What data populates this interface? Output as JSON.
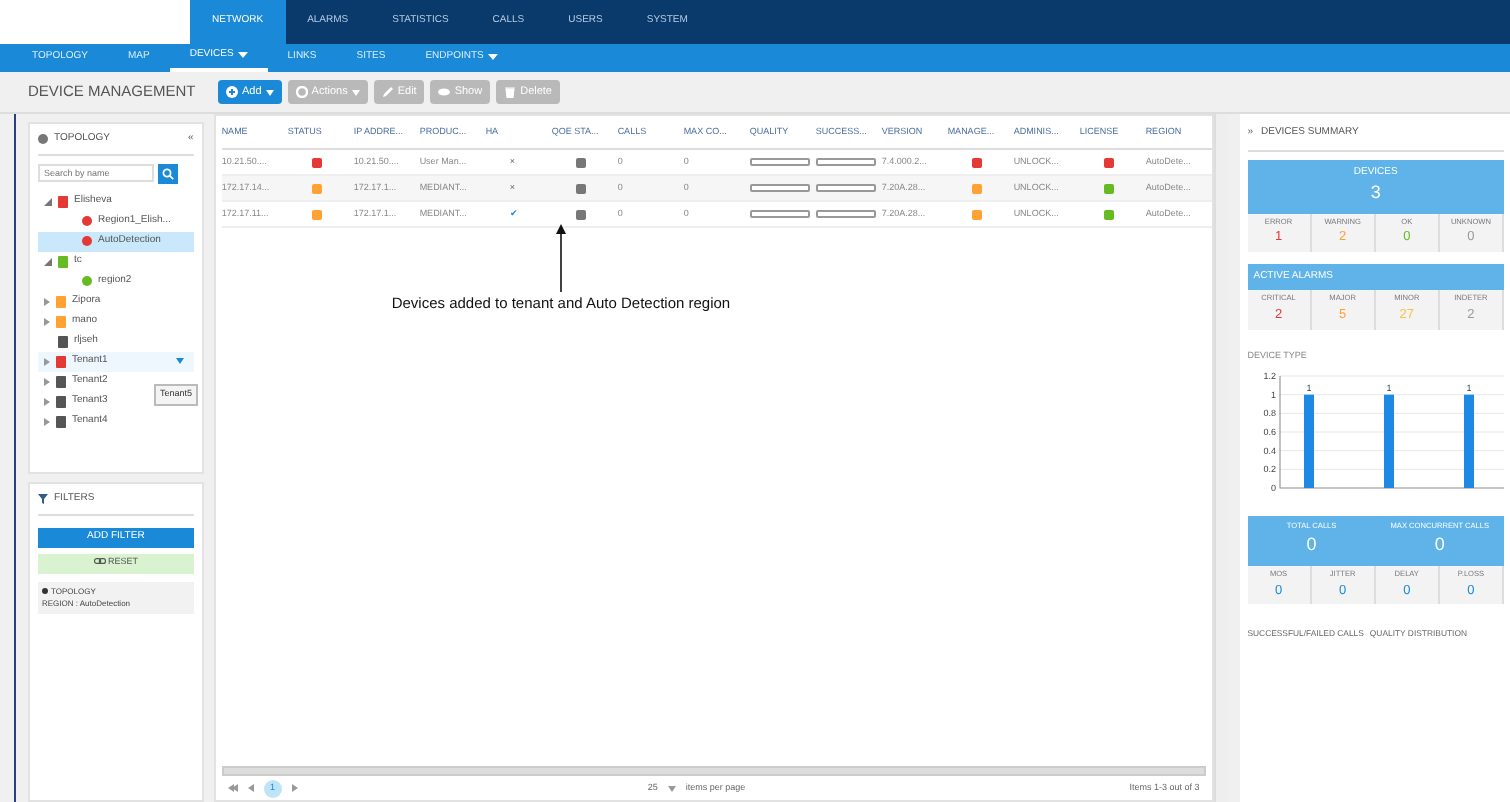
{
  "top_nav": {
    "tabs": [
      {
        "label": "NETWORK",
        "selected": true
      },
      {
        "label": "ALARMS",
        "selected": false
      },
      {
        "label": "STATISTICS",
        "selected": false
      },
      {
        "label": "CALLS",
        "selected": false
      },
      {
        "label": "USERS",
        "selected": false
      },
      {
        "label": "SYSTEM",
        "selected": false
      }
    ]
  },
  "sub_nav": {
    "tabs": [
      {
        "label": "TOPOLOGY",
        "selected": false,
        "dropdown": false
      },
      {
        "label": "MAP",
        "selected": false,
        "dropdown": false
      },
      {
        "label": "DEVICES",
        "selected": true,
        "dropdown": true
      },
      {
        "label": "LINKS",
        "selected": false,
        "dropdown": false
      },
      {
        "label": "SITES",
        "selected": false,
        "dropdown": false
      },
      {
        "label": "ENDPOINTS",
        "selected": false,
        "dropdown": true
      }
    ]
  },
  "page_title": "DEVICE MANAGEMENT",
  "toolbar": [
    {
      "label": "Add",
      "primary": true,
      "dropdown": true
    },
    {
      "label": "Actions",
      "primary": false,
      "dropdown": true
    },
    {
      "label": "Edit",
      "primary": false,
      "dropdown": false
    },
    {
      "label": "Show",
      "primary": false,
      "dropdown": false
    },
    {
      "label": "Delete",
      "primary": false,
      "dropdown": false
    }
  ],
  "topology": {
    "title": "TOPOLOGY",
    "collapse": "«",
    "search": {
      "placeholder": "Search by name"
    },
    "tree": [
      {
        "label": "Elisheva",
        "color": "#e53935",
        "kind": "tenant",
        "expanded": true,
        "selected": false,
        "children": [
          {
            "label": "Region1_Elish...",
            "color": "#e53935",
            "kind": "region",
            "selected": false
          },
          {
            "label": "AutoDetection",
            "color": "#e53935",
            "kind": "region",
            "selected": true
          }
        ]
      },
      {
        "label": "tc",
        "color": "#66bb22",
        "kind": "tenant",
        "expanded": true,
        "selected": false,
        "children": [
          {
            "label": "region2",
            "color": "#66bb22",
            "kind": "region",
            "selected": false
          }
        ]
      },
      {
        "label": "Zipora",
        "color": "#ffa133",
        "kind": "tenant",
        "expanded": false,
        "selected": false
      },
      {
        "label": "mano",
        "color": "#ffa133",
        "kind": "tenant",
        "expanded": false,
        "selected": false
      },
      {
        "label": "rljseh",
        "color": "#555555",
        "kind": "tenant",
        "selected": false
      },
      {
        "label": "Tenant1",
        "color": "#e53935",
        "kind": "tenant",
        "expanded": false,
        "selected": false,
        "hovered": true
      },
      {
        "label": "Tenant2",
        "color": "#555555",
        "kind": "tenant",
        "expanded": false,
        "selected": false
      },
      {
        "label": "Tenant3",
        "color": "#555555",
        "kind": "tenant",
        "expanded": false,
        "selected": false
      },
      {
        "label": "Tenant4",
        "color": "#555555",
        "kind": "tenant",
        "expanded": false,
        "selected": false
      }
    ],
    "tooltip": "Tenant5"
  },
  "filters": {
    "title": "FILTERS",
    "add_button": "ADD FILTER",
    "reset_button": "RESET",
    "active": [
      {
        "name": "TOPOLOGY",
        "value": "REGION : AutoDetection"
      }
    ]
  },
  "table": {
    "columns": [
      "NAME",
      "STATUS",
      "IP ADDRE...",
      "PRODUC...",
      "HA",
      "QOE STA...",
      "CALLS",
      "MAX CO...",
      "QUALITY",
      "SUCCESS...",
      "VERSION",
      "MANAGE...",
      "ADMINIS...",
      "LICENSE",
      "REGION"
    ],
    "rows": [
      {
        "name": "10.21.50....",
        "status": {
          "color": "#e53935"
        },
        "ip": "10.21.50....",
        "product": "User Man...",
        "ha": "×",
        "qoe": {
          "color": "#777777"
        },
        "calls": "0",
        "max_calls": "0",
        "quality": {
          "level": 0
        },
        "success": {
          "level": 0
        },
        "version": "7.4.000.2...",
        "manage": {
          "color": "#e53935"
        },
        "admin": "UNLOCK...",
        "license": {
          "color": "#e53935"
        },
        "region": "AutoDete..."
      },
      {
        "name": "172.17.14...",
        "status": {
          "color": "#ffa133"
        },
        "ip": "172.17.1...",
        "product": "MEDIANT...",
        "ha": "×",
        "qoe": {
          "color": "#777777"
        },
        "calls": "0",
        "max_calls": "0",
        "quality": {
          "level": 0
        },
        "success": {
          "level": 0
        },
        "version": "7.20A.28...",
        "manage": {
          "color": "#ffa133"
        },
        "admin": "UNLOCK...",
        "license": {
          "color": "#66bb22"
        },
        "region": "AutoDete..."
      },
      {
        "name": "172.17.11...",
        "status": {
          "color": "#ffa133"
        },
        "ip": "172.17.1...",
        "product": "MEDIANT...",
        "ha": "✔",
        "qoe": {
          "color": "#777777"
        },
        "calls": "0",
        "max_calls": "0",
        "quality": {
          "level": 0
        },
        "success": {
          "level": 0
        },
        "version": "7.20A.28...",
        "manage": {
          "color": "#ffa133"
        },
        "admin": "UNLOCK...",
        "license": {
          "color": "#66bb22"
        },
        "region": "AutoDete..."
      }
    ]
  },
  "annotation": "Devices added to tenant and Auto Detection region",
  "pagination": {
    "pages": [
      {
        "label": "1",
        "selected": true
      }
    ],
    "page_size": "25",
    "page_size_label": "items per page",
    "summary": "Items 1-3 out of 3"
  },
  "summary": {
    "title": "DEVICES SUMMARY",
    "expand": "»",
    "devices": {
      "label": "DEVICES",
      "value": "3",
      "stats": [
        {
          "label": "ERROR",
          "value": "1",
          "color": "#e53935"
        },
        {
          "label": "WARNING",
          "value": "2",
          "color": "#ffa133"
        },
        {
          "label": "OK",
          "value": "0",
          "color": "#66bb22"
        },
        {
          "label": "UNKNOWN",
          "value": "0",
          "color": "#999999"
        }
      ]
    },
    "alarms": {
      "label": "ACTIVE ALARMS",
      "stats": [
        {
          "label": "CRITICAL",
          "value": "2",
          "color": "#e53935"
        },
        {
          "label": "MAJOR",
          "value": "5",
          "color": "#ffa133"
        },
        {
          "label": "MINOR",
          "value": "27",
          "color": "#f5c242"
        },
        {
          "label": "INDETER",
          "value": "2",
          "color": "#999999"
        }
      ]
    },
    "device_type": {
      "title": "DEVICE TYPE",
      "chart_data": {
        "type": "bar",
        "values": [
          1,
          1,
          1
        ],
        "ylim": [
          0,
          1.2
        ],
        "yticks": [
          0,
          0.2,
          0.4,
          0.6,
          0.8,
          1,
          1.2
        ],
        "data_labels": true,
        "grid": true
      }
    },
    "calls": {
      "totals": [
        {
          "label": "TOTAL CALLS",
          "value": "0"
        },
        {
          "label": "MAX CONCURRENT CALLS",
          "value": "0"
        }
      ],
      "stats": [
        {
          "label": "MOS",
          "value": "0"
        },
        {
          "label": "JITTER",
          "value": "0"
        },
        {
          "label": "DELAY",
          "value": "0"
        },
        {
          "label": "P.LOSS",
          "value": "0"
        }
      ]
    },
    "links": [
      "SUCCESSFUL/FAILED CALLS",
      "QUALITY DISTRIBUTION"
    ]
  }
}
